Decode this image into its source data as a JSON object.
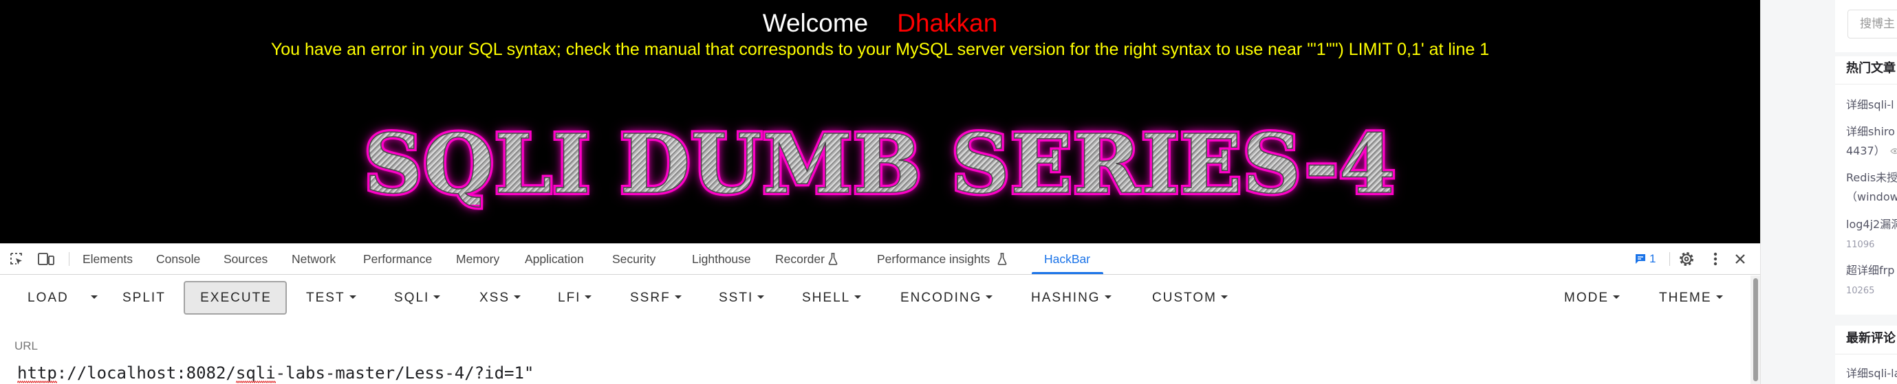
{
  "page": {
    "welcome_label": "Welcome",
    "user_name": "Dhakkan",
    "error_message": "You have an error in your SQL syntax; check the manual that corresponds to your MySQL server version for the right syntax to use near '\"1\"\") LIMIT 0,1' at line 1",
    "logo_text": "SQLI DUMB SERIES-4",
    "colors": {
      "background": "#000000",
      "welcome": "#ffffff",
      "user_name": "#ff0000",
      "error": "#ffff00",
      "logo_glow": "#ff00cc"
    }
  },
  "devtools": {
    "toolbar_icons": [
      "inspect-element-icon",
      "device-toolbar-icon"
    ],
    "tabs": [
      {
        "label": "Elements"
      },
      {
        "label": "Console"
      },
      {
        "label": "Sources"
      },
      {
        "label": "Network"
      },
      {
        "label": "Performance"
      },
      {
        "label": "Memory"
      },
      {
        "label": "Application"
      },
      {
        "label": "Security"
      },
      {
        "label": "Lighthouse"
      },
      {
        "label": "Recorder",
        "icon": "experiment-flask-icon"
      },
      {
        "label": "Performance insights",
        "icon": "experiment-flask-icon"
      },
      {
        "label": "HackBar",
        "active": true
      }
    ],
    "issues_count": "1",
    "right_icons": [
      "issues-icon",
      "settings-gear-icon",
      "more-options-icon",
      "close-icon"
    ],
    "accent_color": "#1a73e8"
  },
  "hackbar": {
    "load_label": "LOAD",
    "split_label": "SPLIT",
    "execute_label": "EXECUTE",
    "menus": [
      "TEST",
      "SQLI",
      "XSS",
      "LFI",
      "SSRF",
      "SSTI",
      "SHELL",
      "ENCODING",
      "HASHING",
      "CUSTOM"
    ],
    "right_menus": [
      "MODE",
      "THEME"
    ],
    "url_label": "URL",
    "url_value": "http://localhost:8082/sqli-labs-master/Less-4/?id=1\""
  },
  "sidebar": {
    "search_placeholder": "搜博主",
    "hot_articles": {
      "title": "热门文章",
      "items": [
        {
          "lines": [
            "详细sqli-l"
          ]
        },
        {
          "lines": [
            "详细shiro",
            "4437）"
          ]
        },
        {
          "lines": [
            "Redis未授",
            "（window"
          ]
        },
        {
          "lines": [
            "log4j2漏洞"
          ],
          "views": "11096"
        },
        {
          "lines": [
            "超详细frp"
          ],
          "views": "10265"
        }
      ]
    },
    "latest_comments": {
      "title": "最新评论",
      "items": [
        {
          "lines": [
            "详细sqli-la"
          ]
        }
      ]
    }
  }
}
